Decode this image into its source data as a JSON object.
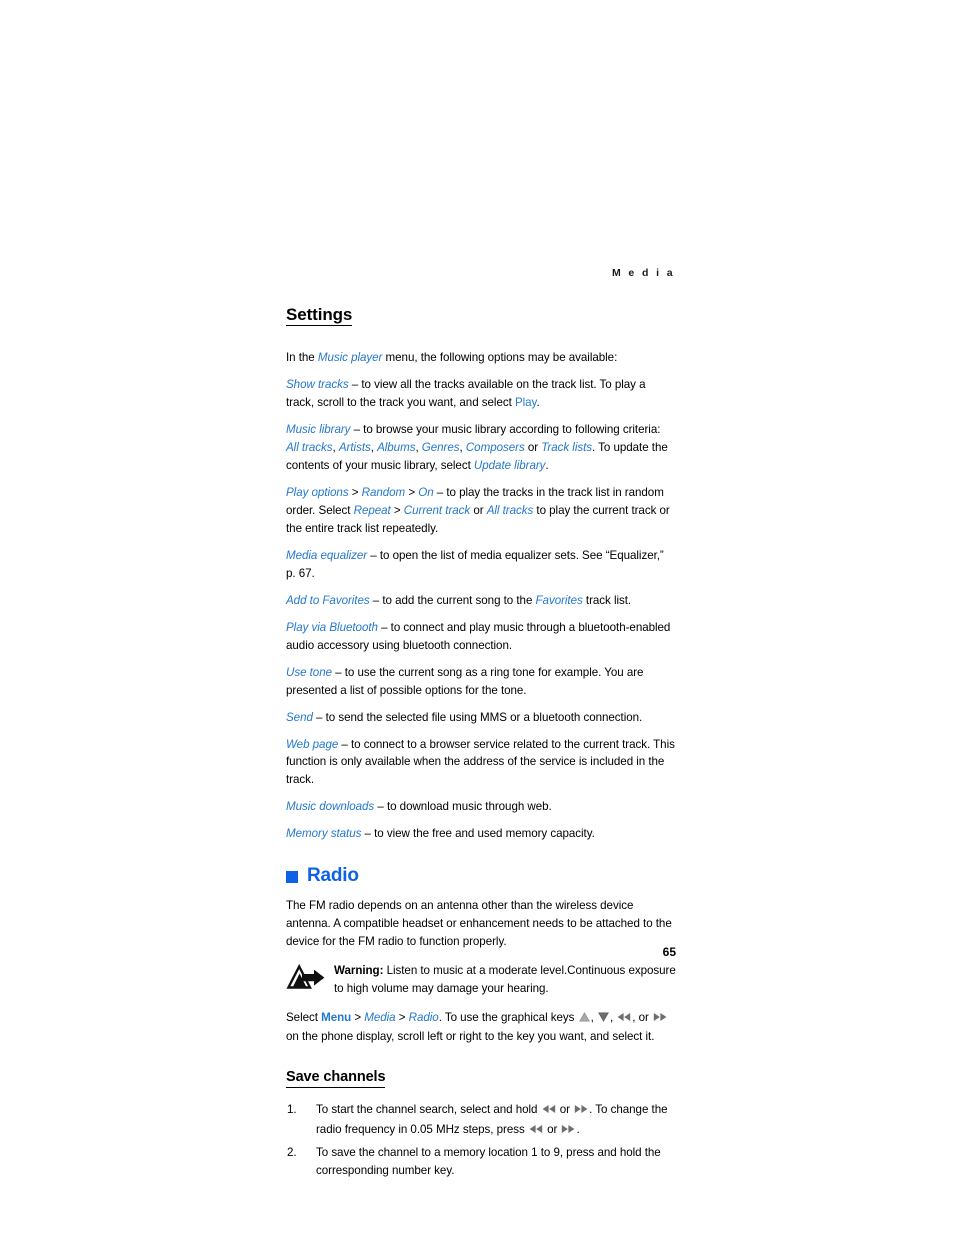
{
  "header": {
    "running_head": "M e d i a"
  },
  "settings": {
    "title": "Settings",
    "intro_pre": "In the ",
    "intro_link": "Music player",
    "intro_post": " menu, the following options may be available:",
    "items": [
      {
        "term": "Show tracks",
        "dash": " – ",
        "text_1": "to view all the tracks available on the track list. To play a track, scroll to the track you want, and select ",
        "link_1": "Play",
        "text_2": "."
      },
      {
        "term": "Music library",
        "dash": " – ",
        "text_1": "to browse your music library according to following criteria: ",
        "criteria": [
          "All tracks",
          "Artists",
          "Albums",
          "Genres",
          "Composers"
        ],
        "criteria_or": " or ",
        "criteria_last": "Track lists",
        "text_2": ". To update the contents of your music library, select ",
        "link_2": "Update library",
        "text_3": "."
      },
      {
        "term_1": "Play options",
        "sep_1": " > ",
        "term_2": "Random",
        "sep_2": " > ",
        "term_3": "On",
        "dash": " – ",
        "text_1": "to play the tracks in the track list in random order. Select ",
        "link_1": "Repeat",
        "sep_3": " > ",
        "link_2": "Current track",
        "text_2": " or ",
        "link_3": "All tracks",
        "text_3": " to play the current track or the entire track list repeatedly."
      },
      {
        "term": "Media equalizer",
        "dash": " – ",
        "text_1": "to open the list of media equalizer sets. See “Equalizer,” p. 67."
      },
      {
        "term": "Add to Favorites",
        "dash": " – ",
        "text_1": "to add the current song to the ",
        "link_1": "Favorites",
        "text_2": " track list."
      },
      {
        "term": "Play via Bluetooth",
        "dash": " – ",
        "text_1": "to connect and play music through a bluetooth-enabled audio accessory using bluetooth connection."
      },
      {
        "term": "Use tone",
        "dash": " – ",
        "text_1": "to use the current song as a ring tone for example. You are presented a list of possible options for the tone."
      },
      {
        "term": "Send",
        "dash": " – ",
        "text_1": "to send the selected file using MMS or a bluetooth connection."
      },
      {
        "term": "Web page",
        "dash": " – ",
        "text_1": "to connect to a browser service related to the current track. This function is only available when the address of the service is included in the track."
      },
      {
        "term": "Music downloads",
        "dash": " – ",
        "text_1": "to download music through web."
      },
      {
        "term": "Memory status",
        "dash": " – ",
        "text_1": "to view the free and used memory capacity."
      }
    ]
  },
  "radio": {
    "title": "Radio",
    "bullet_icon": "square-bullet-icon",
    "intro": "The FM radio depends on an antenna other than the wireless device antenna. A compatible headset or enhancement needs to be attached to the device for the FM radio to function properly.",
    "warning": {
      "icon": "warning-triangle-arrow-icon",
      "label": "Warning:",
      "text": " Listen to music at a moderate level.Continuous exposure to high volume may damage your hearing."
    },
    "select_path": {
      "pre": "Select ",
      "menu": "Menu",
      "sep_1": " > ",
      "media": "Media",
      "sep_2": " > ",
      "radio": "Radio",
      "mid": ". To use the graphical keys ",
      "key_up": "up-arrow-key-icon",
      "comma_1": ", ",
      "key_down": "down-arrow-key-icon",
      "comma_2": ", ",
      "key_rewind": "rewind-key-icon",
      "comma_3": ", or ",
      "key_forward": "fast-forward-key-icon",
      "post": " on the phone display, scroll left or right to the key you want, and select it."
    }
  },
  "save_channels": {
    "title": "Save channels",
    "steps": [
      {
        "num": "1.",
        "text_1": "To start the channel search, select and hold ",
        "icon_1": "rewind-key-icon",
        "text_2": " or ",
        "icon_2": "fast-forward-key-icon",
        "text_3": ". To change the radio frequency in 0.05 MHz steps, press ",
        "icon_3": "rewind-key-icon",
        "text_4": " or ",
        "icon_4": "fast-forward-key-icon",
        "text_5": "."
      },
      {
        "num": "2.",
        "text_1": "To save the channel to a memory location 1 to 9, press and hold the corresponding number key."
      }
    ]
  },
  "footer": {
    "page_number": "65"
  },
  "colors": {
    "link_blue": "#2478cf",
    "heading_blue": "#0f62e6",
    "text_black": "#000000",
    "key_icon_gray": "#7a7a7a"
  }
}
